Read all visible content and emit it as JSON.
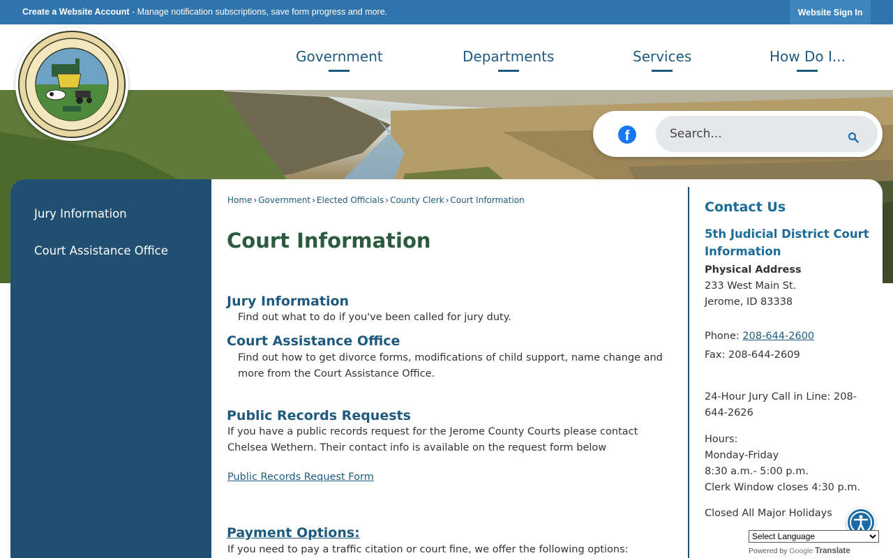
{
  "topbar": {
    "account_link": "Create a Website Account",
    "account_desc": " - Manage notification subscriptions, save form progress and more.",
    "sign_in": "Website Sign In"
  },
  "header": {
    "seal_alt": "THE SEAL OF JEROME COUNTY",
    "nav": [
      "Government",
      "Departments",
      "Services",
      "How Do I..."
    ]
  },
  "search": {
    "placeholder": "Search...",
    "social_icon": "facebook-icon",
    "search_icon": "search-icon"
  },
  "sidebar": {
    "items": [
      "Jury Information",
      "Court Assistance Office"
    ]
  },
  "breadcrumb": [
    "Home",
    "Government",
    "Elected Officials",
    "County Clerk",
    "Court Information"
  ],
  "main": {
    "title": "Court Information",
    "jury_heading": "Jury Information",
    "jury_desc": "Find out what to do if you've been called for jury duty.",
    "cao_heading": "Court Assistance Office",
    "cao_desc": "Find out how to get divorce forms, modifications of child support, name change and more from the Court Assistance Office.",
    "records_heading": "Public Records Requests",
    "records_desc": "If you have a public records request for the Jerome County Courts please contact Chelsea Wethern. Their contact info is available on the request form below",
    "records_link": "Public Records Request Form",
    "payment_heading": "Payment Options:",
    "payment_desc": "If you need to pay a traffic citation or court fine, we offer the following options:"
  },
  "contact": {
    "heading": "Contact Us",
    "org": "5th Judicial District Court Information",
    "address_label": "Physical Address",
    "street": "233 West Main St.",
    "city": "Jerome, ID 83338",
    "phone_label": "Phone: ",
    "phone": "208-644-2600",
    "fax": "Fax: 208-644-2609",
    "jury_line_1": "24-Hour Jury Call in Line: 208-",
    "jury_line_2": "644-2626",
    "hours_label": "Hours:",
    "days": "Monday-Friday",
    "time": "8:30 a.m.- 5:00 p.m.",
    "clerk": "Clerk Window closes 4:30 p.m.",
    "holidays": "Closed All Major Holidays"
  },
  "translate": {
    "select_label": "Select Language",
    "powered_by": "Powered by",
    "google": "Google",
    "translate": "Translate"
  },
  "colors": {
    "topbar": "#2f74ad",
    "nav_text": "#1f5a7e",
    "sidebar": "#214f72",
    "title_green": "#2b5a3e",
    "contact_blue": "#1a6b98"
  }
}
